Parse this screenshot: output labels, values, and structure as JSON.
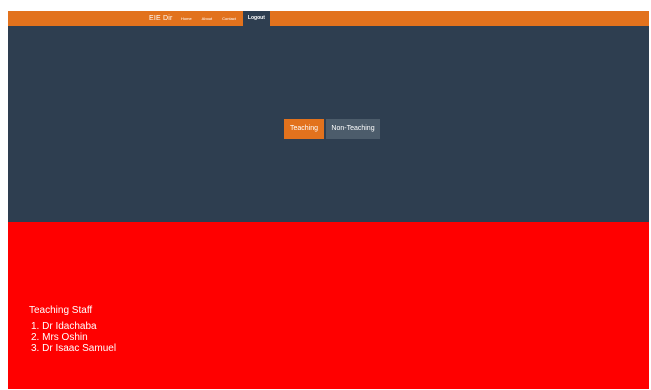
{
  "navbar": {
    "brand": "EIE Dir",
    "items": [
      {
        "label": "Home"
      },
      {
        "label": "About"
      },
      {
        "label": "Contact"
      },
      {
        "label": "Logout"
      }
    ]
  },
  "hero": {
    "buttons": {
      "teaching": "Teaching",
      "non_teaching": "Non-Teaching"
    }
  },
  "staff": {
    "title": "Teaching Staff",
    "list": [
      "1. Dr Idachaba",
      "2. Mrs Oshin",
      "3. Dr Isaac Samuel"
    ]
  },
  "colors": {
    "accent": "#e2721d",
    "dark": "#2e3e50",
    "section_bg": "#ff0000"
  }
}
